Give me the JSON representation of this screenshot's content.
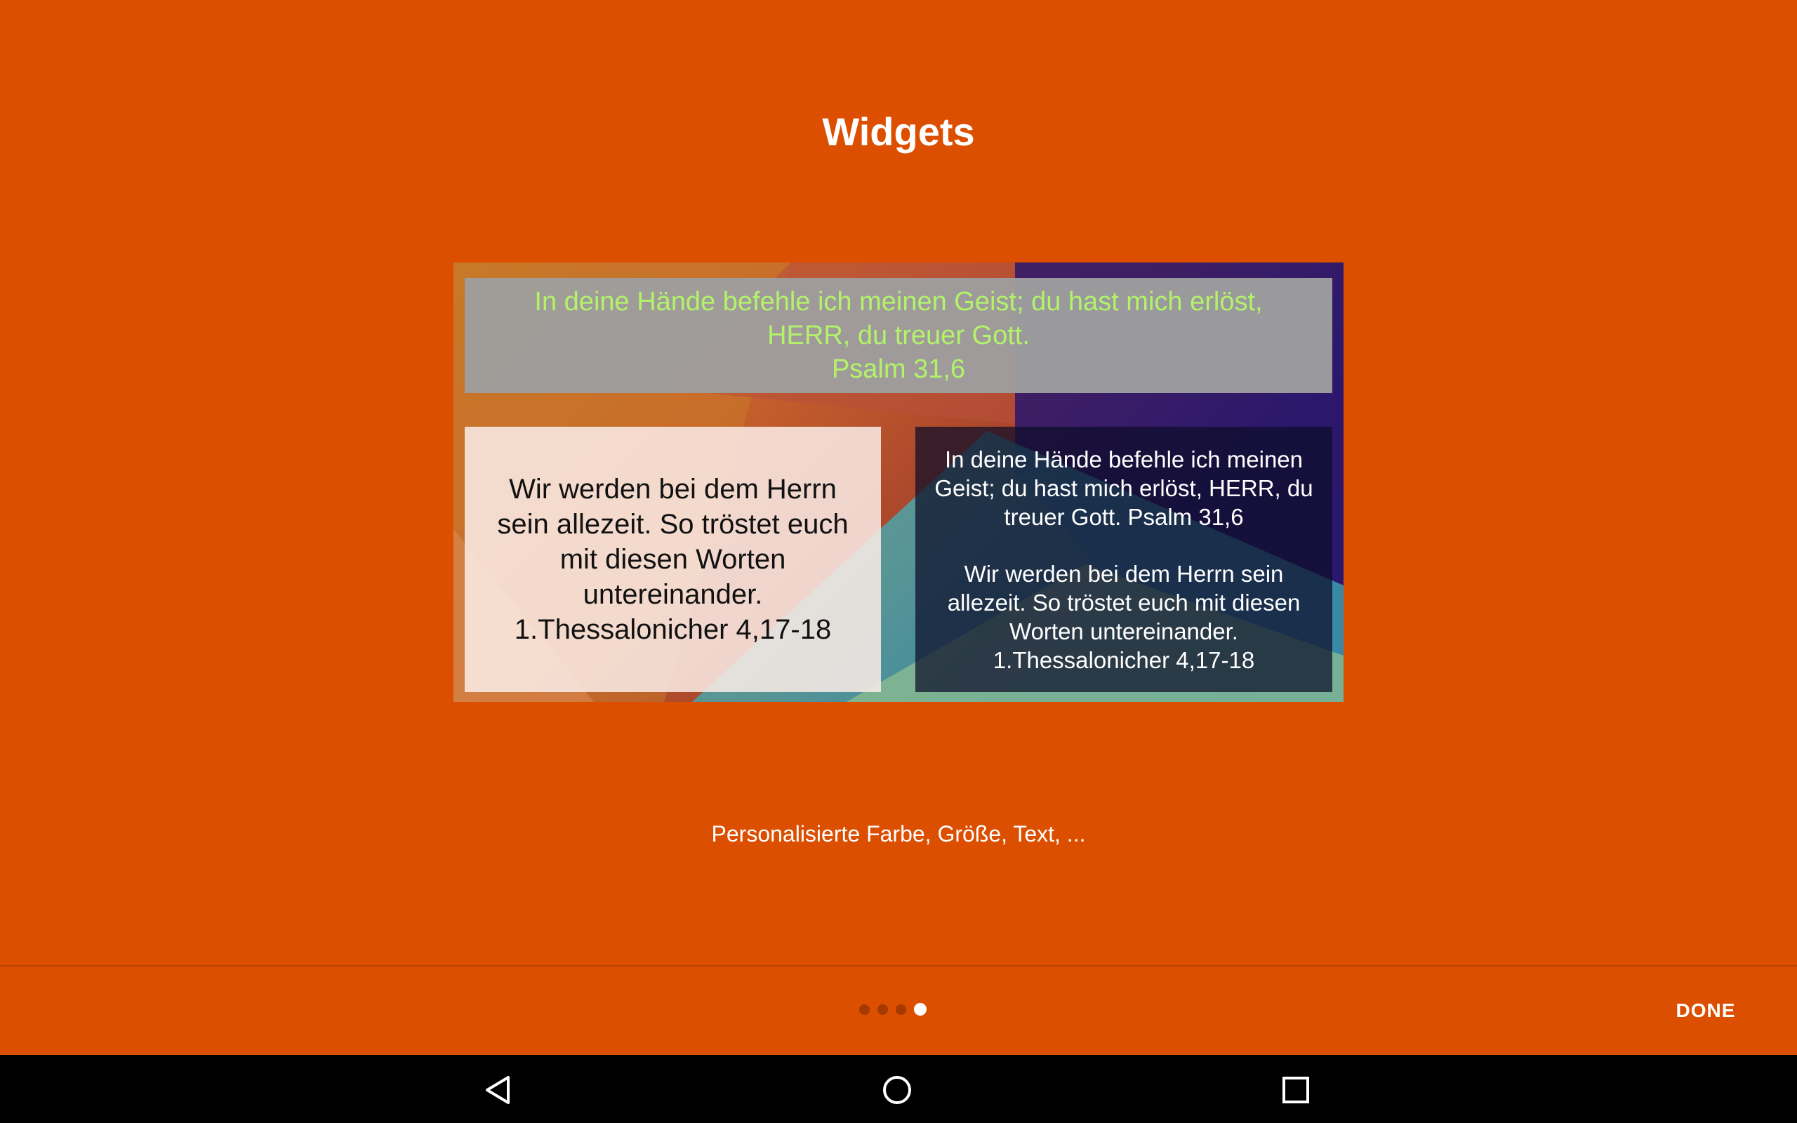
{
  "screen": {
    "title": "Widgets",
    "subtitle": "Personalisierte Farbe, Größe, Text, ...",
    "background_color": "#DC4E00"
  },
  "preview": {
    "top_widget": {
      "line1": "In deine Hände befehle ich meinen Geist; du hast mich erlöst,",
      "line2": "HERR, du treuer Gott.",
      "line3": "Psalm 31,6",
      "text_color": "#B2F36A"
    },
    "left_widget": {
      "text": "Wir werden bei dem Herrn sein allezeit. So tröstet euch mit diesen Worten untereinander. 1.Thessalonicher 4,17-18"
    },
    "right_widget": {
      "verse1": "In deine Hände befehle ich meinen Geist; du hast mich erlöst, HERR, du treuer Gott. Psalm 31,6",
      "verse2": "Wir werden bei dem Herrn sein allezeit. So tröstet euch mit diesen Worten untereinander. 1.Thessalonicher 4,17-18"
    }
  },
  "pager": {
    "page_count": 4,
    "current_page": 4,
    "done_label": "DONE"
  },
  "navbar": {
    "icons": [
      "back-icon",
      "home-icon",
      "recents-icon"
    ]
  }
}
